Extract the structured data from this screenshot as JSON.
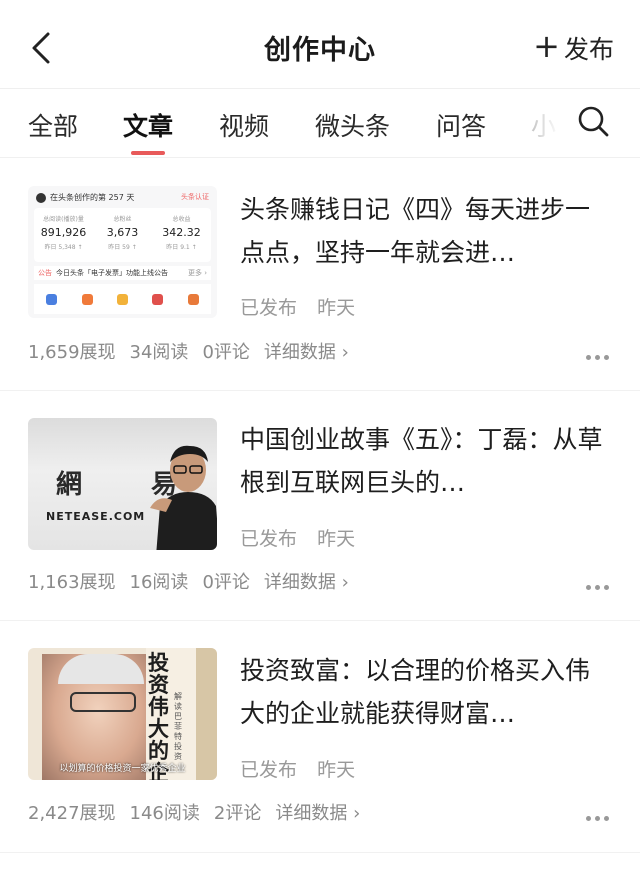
{
  "header": {
    "back_icon": "chevron-left-icon",
    "title": "创作中心",
    "publish_icon": "plus-icon",
    "publish_label": "发布"
  },
  "tabs": {
    "items": [
      "全部",
      "文章",
      "视频",
      "微头条",
      "问答",
      "小"
    ],
    "active_index": 1,
    "search_icon": "search-icon"
  },
  "colors": {
    "accent": "#e85a5a",
    "muted_text": "#8a8a8a"
  },
  "articles": [
    {
      "title": "头条赚钱日记《四》每天进步一点点，坚持一年就会进…",
      "status": "已发布",
      "time": "昨天",
      "stats": [
        "1,659展现",
        "34阅读",
        "0评论"
      ],
      "detail_label": "详细数据",
      "thumb": {
        "header_text": "在头条创作的第 257 天",
        "badge": "头条认证",
        "columns": [
          {
            "label": "总阅读(播放)量",
            "value": "891,926",
            "sub": "昨日 5,348 ↑"
          },
          {
            "label": "总粉丝",
            "value": "3,673",
            "sub": "昨日 59 ↑"
          },
          {
            "label": "总收益",
            "value": "342.32",
            "sub": "昨日 9.1 ↑"
          }
        ],
        "notice_tag": "公告",
        "notice_text": "今日头条「电子发票」功能上线公告",
        "notice_more": "更多 ›"
      }
    },
    {
      "title": "中国创业故事《五》：丁磊：从草根到互联网巨头的…",
      "status": "已发布",
      "time": "昨天",
      "stats": [
        "1,163展现",
        "16阅读",
        "0评论"
      ],
      "detail_label": "详细数据",
      "thumb": {
        "sign_text": "網 易",
        "url_text": "NETEASE.COM"
      }
    },
    {
      "title": "投资致富：以合理的价格买入伟大的企业就能获得财富…",
      "status": "已发布",
      "time": "昨天",
      "stats": [
        "2,427展现",
        "146阅读",
        "2评论"
      ],
      "detail_label": "详细数据",
      "thumb": {
        "book_title": "投资伟大的企",
        "book_sub": "解读巴菲特投资",
        "caption": "以划算的价格投资一家优秀企业"
      }
    }
  ]
}
